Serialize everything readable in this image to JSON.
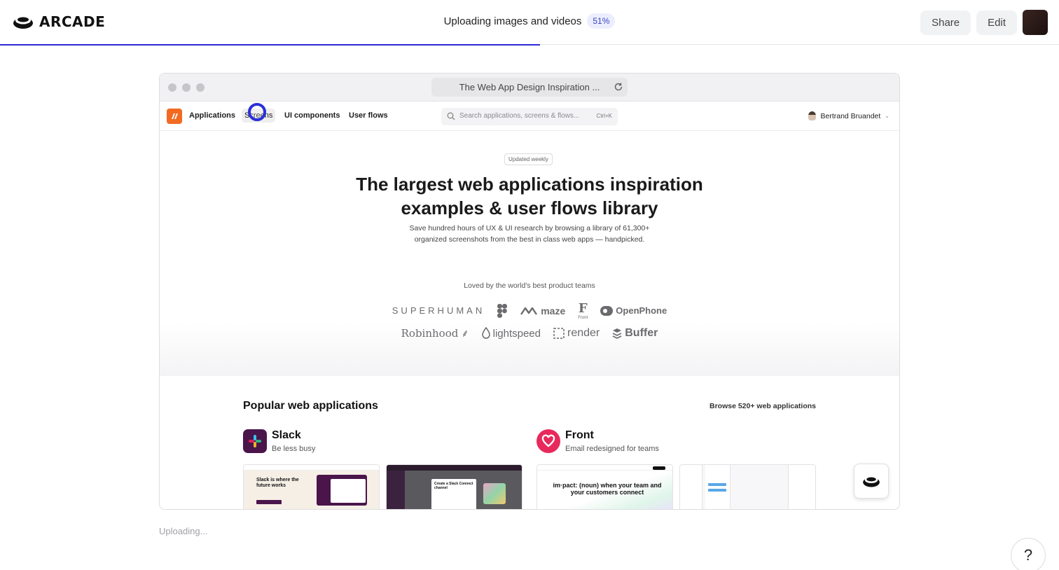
{
  "brand": {
    "name": "ARCADE"
  },
  "upload": {
    "label": "Uploading images and videos",
    "percent_label": "51%",
    "progress": 0.51,
    "footer_status": "Uploading..."
  },
  "actions": {
    "share_label": "Share",
    "edit_label": "Edit"
  },
  "browser": {
    "tab_title": "The Web App Design Inspiration ...",
    "nav": {
      "items": [
        "Applications",
        "Screens",
        "UI components",
        "User flows"
      ],
      "search_placeholder": "Search applications, screens & flows...",
      "search_shortcut": "Ctrl+K",
      "user_name": "Bertrand Bruandet"
    },
    "hero": {
      "badge": "Updated weekly",
      "title_line1": "The largest web applications inspiration",
      "title_line2": "examples & user flows library",
      "subtitle_line1": "Save hundred hours of UX & UI research by browsing a library of 61,300+",
      "subtitle_line2": "organized screenshots from the best in class web apps — handpicked.",
      "loved_by": "Loved by the world's best product teams",
      "logos_row1": [
        "SUPERHUMAN",
        "Figma",
        "maze",
        "Front",
        "OpenPhone"
      ],
      "logos_row2": [
        "Robinhood",
        "lightspeed",
        "render",
        "Buffer"
      ],
      "front_logo_caption": "Front"
    },
    "popular": {
      "title": "Popular web applications",
      "browse_link": "Browse 520+ web applications",
      "apps": [
        {
          "name": "Slack",
          "tagline": "Be less busy",
          "thumb1_text": "Slack is where the future works",
          "thumb2_text": "Create a Slack Connect channel"
        },
        {
          "name": "Front",
          "tagline": "Email redesigned for teams",
          "thumb1_text": "im·pact: (noun) when your team and your customers connect"
        }
      ]
    }
  },
  "help": {
    "label": "?"
  },
  "colors": {
    "accent": "#2f2ad8",
    "brand_orange": "#f26a21",
    "front_pink": "#e8295c",
    "slack_bg": "#4a154b"
  }
}
